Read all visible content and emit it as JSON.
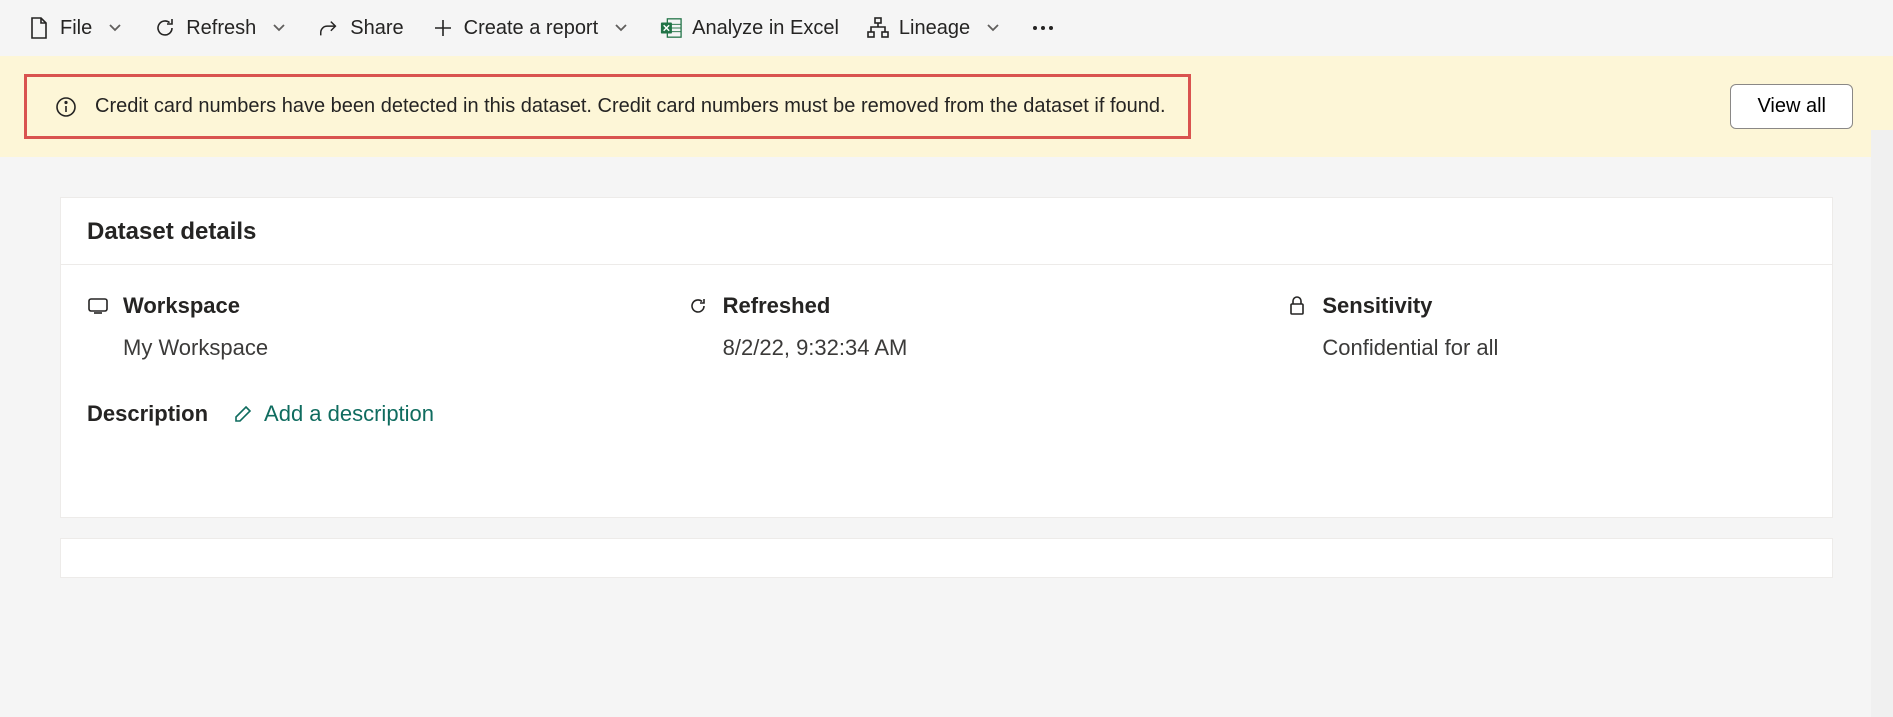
{
  "toolbar": {
    "file": "File",
    "refresh": "Refresh",
    "share": "Share",
    "create_report": "Create a report",
    "analyze_excel": "Analyze in Excel",
    "lineage": "Lineage"
  },
  "notice": {
    "message": "Credit card numbers have been detected in this dataset. Credit card numbers must be removed from the dataset if found.",
    "view_all": "View all"
  },
  "details": {
    "title": "Dataset details",
    "workspace_label": "Workspace",
    "workspace_value": "My Workspace",
    "refreshed_label": "Refreshed",
    "refreshed_value": "8/2/22, 9:32:34 AM",
    "sensitivity_label": "Sensitivity",
    "sensitivity_value": "Confidential for all",
    "description_label": "Description",
    "add_description": "Add a description"
  }
}
